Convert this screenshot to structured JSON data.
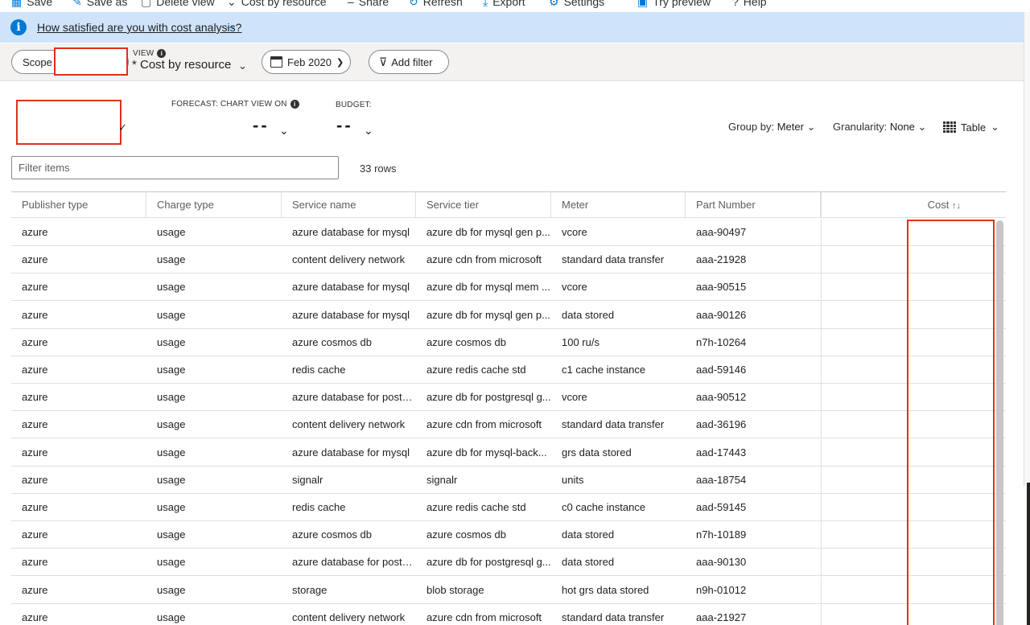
{
  "toolbar": {
    "items": [
      "Save",
      "Save as",
      "Delete view",
      "Cost by resource",
      "Share",
      "Refresh",
      "Export",
      "Settings",
      "Try preview",
      "Help"
    ]
  },
  "banner": {
    "text": "How satisfied are you with cost analysis?",
    "arrow": "→",
    "icon": "info-icon"
  },
  "cmdbar": {
    "scope_label": "Scope",
    "view_label": "VIEW",
    "view_name": "* Cost by resource",
    "date_label": "Feb 2020",
    "add_filter_label": "Add filter"
  },
  "summary": {
    "forecast_label": "FORECAST: CHART VIEW ON",
    "forecast_value": "--",
    "budget_label": "BUDGET:",
    "budget_value": "--"
  },
  "controls": {
    "groupby_label": "Group by:",
    "groupby_value": "Meter",
    "granularity_label": "Granularity:",
    "granularity_value": "None",
    "view_type": "Table"
  },
  "filter": {
    "placeholder": "Filter items",
    "row_count": "33 rows"
  },
  "table": {
    "columns": [
      "Publisher type",
      "Charge type",
      "Service name",
      "Service tier",
      "Meter",
      "Part Number",
      "Cost"
    ],
    "rows": [
      [
        "azure",
        "usage",
        "azure database for mysql",
        "azure db for mysql gen p...",
        "vcore",
        "aaa-90497"
      ],
      [
        "azure",
        "usage",
        "content delivery network",
        "azure cdn from microsoft",
        "standard data transfer",
        "aaa-21928"
      ],
      [
        "azure",
        "usage",
        "azure database for mysql",
        "azure db for mysql mem ...",
        "vcore",
        "aaa-90515"
      ],
      [
        "azure",
        "usage",
        "azure database for mysql",
        "azure db for mysql gen p...",
        "data stored",
        "aaa-90126"
      ],
      [
        "azure",
        "usage",
        "azure cosmos db",
        "azure cosmos db",
        "100 ru/s",
        "n7h-10264"
      ],
      [
        "azure",
        "usage",
        "redis cache",
        "azure redis cache std",
        "c1 cache instance",
        "aad-59146"
      ],
      [
        "azure",
        "usage",
        "azure database for postg...",
        "azure db for postgresql g...",
        "vcore",
        "aaa-90512"
      ],
      [
        "azure",
        "usage",
        "content delivery network",
        "azure cdn from microsoft",
        "standard data transfer",
        "aad-36196"
      ],
      [
        "azure",
        "usage",
        "azure database for mysql",
        "azure db for mysql-back...",
        "grs data stored",
        "aad-17443"
      ],
      [
        "azure",
        "usage",
        "signalr",
        "signalr",
        "units",
        "aaa-18754"
      ],
      [
        "azure",
        "usage",
        "redis cache",
        "azure redis cache std",
        "c0 cache instance",
        "aad-59145"
      ],
      [
        "azure",
        "usage",
        "azure cosmos db",
        "azure cosmos db",
        "data stored",
        "n7h-10189"
      ],
      [
        "azure",
        "usage",
        "azure database for postg...",
        "azure db for postgresql g...",
        "data stored",
        "aaa-90130"
      ],
      [
        "azure",
        "usage",
        "storage",
        "blob storage",
        "hot grs data stored",
        "n9h-01012"
      ],
      [
        "azure",
        "usage",
        "content delivery network",
        "azure cdn from microsoft",
        "standard data transfer",
        "aaa-21927"
      ]
    ]
  },
  "colors": {
    "accent": "#0078d4",
    "banner_bg": "#cfe4fa",
    "redaction": "#e0301e"
  }
}
